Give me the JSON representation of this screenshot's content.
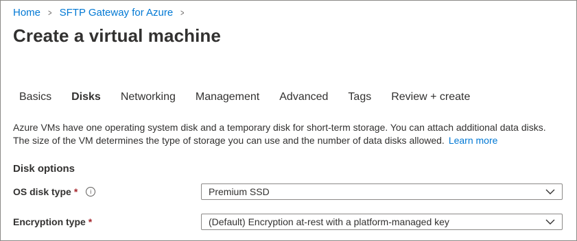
{
  "breadcrumb": {
    "items": [
      "Home",
      "SFTP Gateway for Azure"
    ],
    "separator": ">"
  },
  "page_title": "Create a virtual machine",
  "tabs": [
    {
      "label": "Basics"
    },
    {
      "label": "Disks",
      "active": true
    },
    {
      "label": "Networking"
    },
    {
      "label": "Management"
    },
    {
      "label": "Advanced"
    },
    {
      "label": "Tags"
    },
    {
      "label": "Review + create"
    }
  ],
  "intro": {
    "line1": "Azure VMs have one operating system disk and a temporary disk for short-term storage. You can attach additional data disks.",
    "line2": "The size of the VM determines the type of storage you can use and the number of data disks allowed.",
    "link": "Learn more"
  },
  "disk_options": {
    "heading": "Disk options",
    "os_disk_type": {
      "label": "OS disk type",
      "required_mark": "*",
      "info_icon": "i",
      "value": "Premium SSD"
    },
    "encryption_type": {
      "label": "Encryption type",
      "required_mark": "*",
      "value": "(Default) Encryption at-rest with a platform-managed key"
    }
  },
  "colors": {
    "link": "#0078d4",
    "text": "#323130",
    "required": "#a4262c",
    "border": "#8a8886"
  }
}
